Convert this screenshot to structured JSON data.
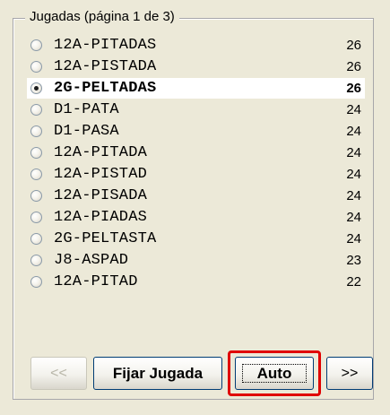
{
  "group_title": "Jugadas (página 1 de 3)",
  "plays": [
    {
      "word": "12A-PITADAS",
      "score": "26",
      "selected": false
    },
    {
      "word": "12A-PISTADA",
      "score": "26",
      "selected": false
    },
    {
      "word": "2G-PELTADAS",
      "score": "26",
      "selected": true
    },
    {
      "word": "D1-PATA",
      "score": "24",
      "selected": false
    },
    {
      "word": "D1-PASA",
      "score": "24",
      "selected": false
    },
    {
      "word": "12A-PITADA",
      "score": "24",
      "selected": false
    },
    {
      "word": "12A-PISTAD",
      "score": "24",
      "selected": false
    },
    {
      "word": "12A-PISADA",
      "score": "24",
      "selected": false
    },
    {
      "word": "12A-PIADAS",
      "score": "24",
      "selected": false
    },
    {
      "word": "2G-PELTASTA",
      "score": "24",
      "selected": false
    },
    {
      "word": "J8-ASPAD",
      "score": "23",
      "selected": false
    },
    {
      "word": "12A-PITAD",
      "score": "22",
      "selected": false
    }
  ],
  "buttons": {
    "prev_label": "<<",
    "fix_label": "Fijar Jugada",
    "auto_label": "Auto",
    "next_label": ">>"
  },
  "highlight_color": "#e00000"
}
